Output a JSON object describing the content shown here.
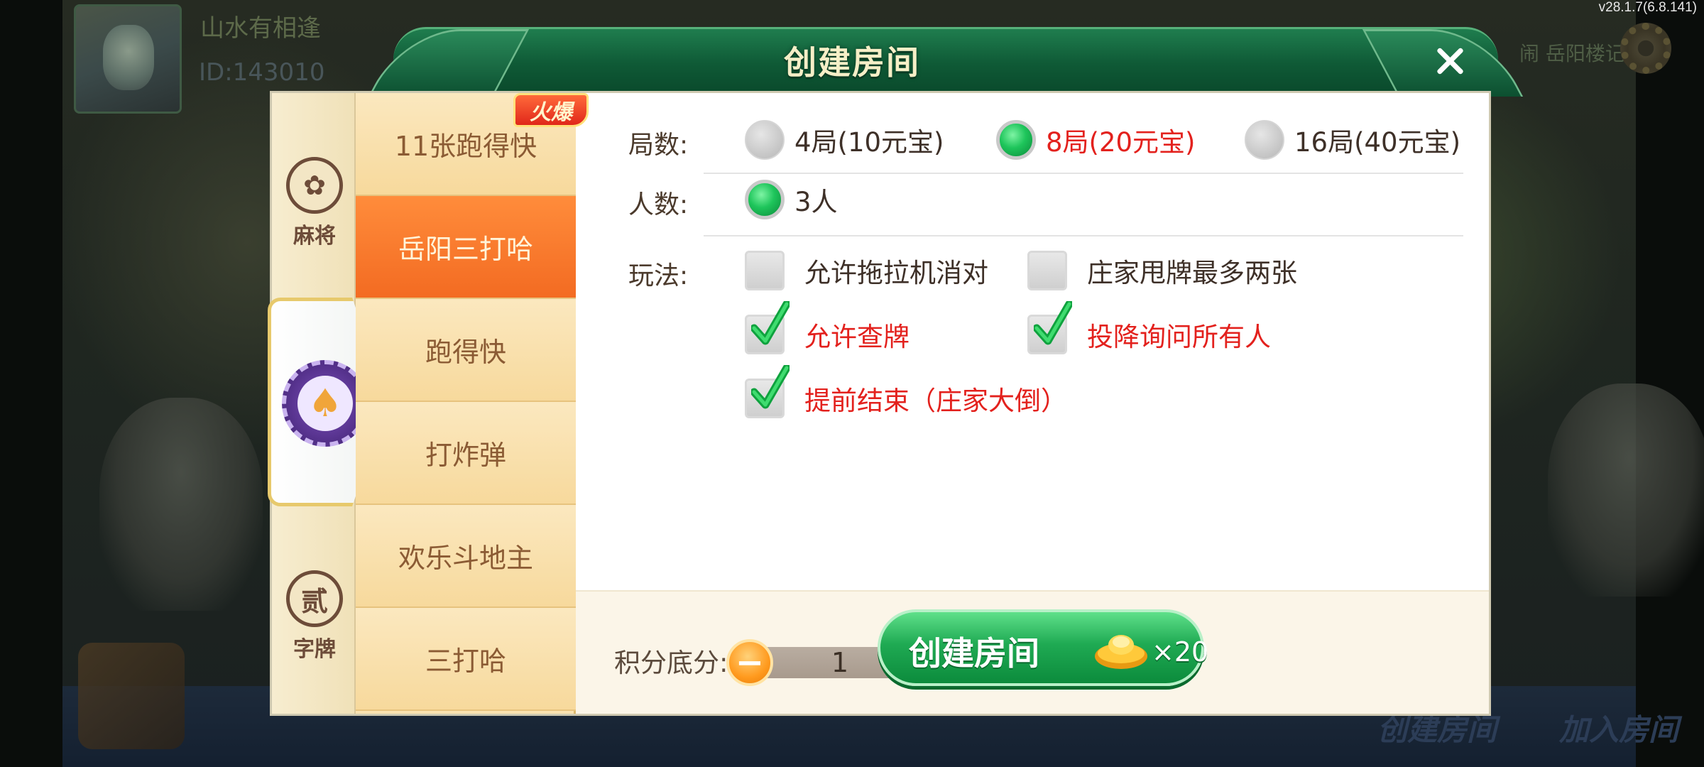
{
  "version": "v28.1.7(6.8.141)",
  "background": {
    "player_name": "山水有相逢",
    "player_id": "ID:143010",
    "top_right_text": "闹  岳阳楼记",
    "bottom_buttons": [
      "创建房间",
      "加入房间"
    ]
  },
  "dialog": {
    "title": "创建房间",
    "categories": [
      {
        "label": "麻将",
        "icon": "mahjong-flower-icon"
      },
      {
        "label": "",
        "icon": "spade-chip-icon"
      },
      {
        "label": "字牌",
        "icon": "zipai-er-icon",
        "glyph": "贰"
      }
    ],
    "games": [
      {
        "label": "11张跑得快",
        "badge": "火爆"
      },
      {
        "label": "岳阳三打哈",
        "active": true
      },
      {
        "label": "跑得快"
      },
      {
        "label": "打炸弹"
      },
      {
        "label": "欢乐斗地主"
      },
      {
        "label": "三打哈"
      }
    ],
    "rounds": {
      "label": "局数:",
      "options": [
        "4局(10元宝)",
        "8局(20元宝)",
        "16局(40元宝)"
      ],
      "selected": "8局(20元宝)"
    },
    "players": {
      "label": "人数:",
      "options": [
        "3人"
      ],
      "selected": "3人"
    },
    "rules": {
      "label": "玩法:",
      "options": [
        {
          "text": "允许拖拉机消对",
          "checked": false
        },
        {
          "text": "庄家甩牌最多两张",
          "checked": false
        },
        {
          "text": "允许查牌",
          "checked": true
        },
        {
          "text": "投降询问所有人",
          "checked": true
        },
        {
          "text": "提前结束（庄家大倒）",
          "checked": true
        }
      ]
    },
    "score": {
      "label": "积分底分:",
      "value": "1",
      "minus": "−",
      "plus": "+"
    },
    "create_button": {
      "label": "创建房间",
      "cost": "×20"
    }
  },
  "colors": {
    "selected_text": "#e3211d",
    "active_game": "#f36b22",
    "header_green": "#0f5a36",
    "create_green": "#1faa53"
  }
}
